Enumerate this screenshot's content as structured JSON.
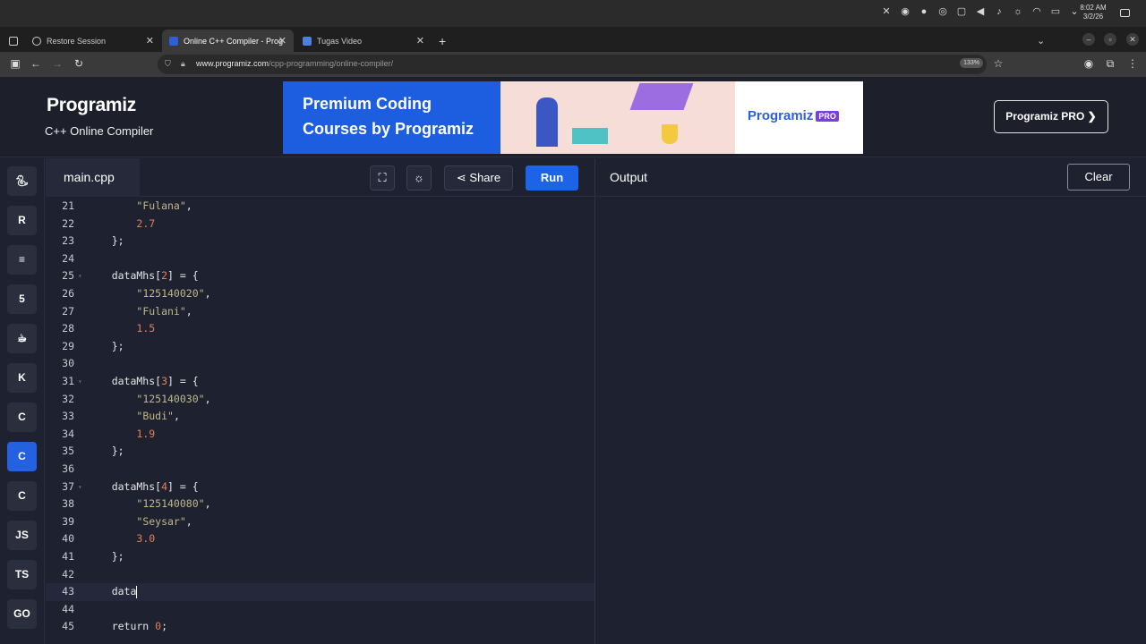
{
  "os": {
    "time": "8:02 AM",
    "date": "3/2/26"
  },
  "browser": {
    "tabs": [
      {
        "label": "Restore Session"
      },
      {
        "label": "Online C++ Compiler - Prog"
      },
      {
        "label": "Tugas Video"
      }
    ],
    "url_domain": "www.programiz.com",
    "url_path": "/cpp-programming/online-compiler/",
    "zoom": "133%"
  },
  "site": {
    "logo": "Programiz",
    "subtitle": "C++ Online Compiler",
    "banner_line1": "Premium Coding",
    "banner_line2": "Courses by Programiz",
    "banner_logo": "Programiz",
    "banner_badge": "PRO",
    "pro_button": "Programiz PRO ❯"
  },
  "rail": [
    "Python",
    "R",
    "SQL",
    "HTML",
    "Java",
    "Kotlin",
    "C",
    "C++",
    "C#",
    "JS",
    "TS",
    "GO"
  ],
  "rail_labels": {
    "js": "JS",
    "ts": "TS",
    "go": "GO"
  },
  "editor": {
    "filename": "main.cpp",
    "share_label": "Share",
    "run_label": "Run"
  },
  "code_lines": [
    {
      "n": "21",
      "t": "        \"Fulana\","
    },
    {
      "n": "22",
      "t": "        2.7"
    },
    {
      "n": "23",
      "t": "    };"
    },
    {
      "n": "24",
      "t": ""
    },
    {
      "n": "25",
      "t": "    dataMhs[2] = {"
    },
    {
      "n": "26",
      "t": "        \"125140020\","
    },
    {
      "n": "27",
      "t": "        \"Fulani\","
    },
    {
      "n": "28",
      "t": "        1.5"
    },
    {
      "n": "29",
      "t": "    };"
    },
    {
      "n": "30",
      "t": ""
    },
    {
      "n": "31",
      "t": "    dataMhs[3] = {"
    },
    {
      "n": "32",
      "t": "        \"125140030\","
    },
    {
      "n": "33",
      "t": "        \"Budi\","
    },
    {
      "n": "34",
      "t": "        1.9"
    },
    {
      "n": "35",
      "t": "    };"
    },
    {
      "n": "36",
      "t": ""
    },
    {
      "n": "37",
      "t": "    dataMhs[4] = {"
    },
    {
      "n": "38",
      "t": "        \"125140080\","
    },
    {
      "n": "39",
      "t": "        \"Seysar\","
    },
    {
      "n": "40",
      "t": "        3.0"
    },
    {
      "n": "41",
      "t": "    };"
    },
    {
      "n": "42",
      "t": ""
    },
    {
      "n": "43",
      "t": "    data"
    },
    {
      "n": "44",
      "t": ""
    },
    {
      "n": "45",
      "t": "    return 0;"
    }
  ],
  "output": {
    "title": "Output",
    "clear_label": "Clear"
  }
}
